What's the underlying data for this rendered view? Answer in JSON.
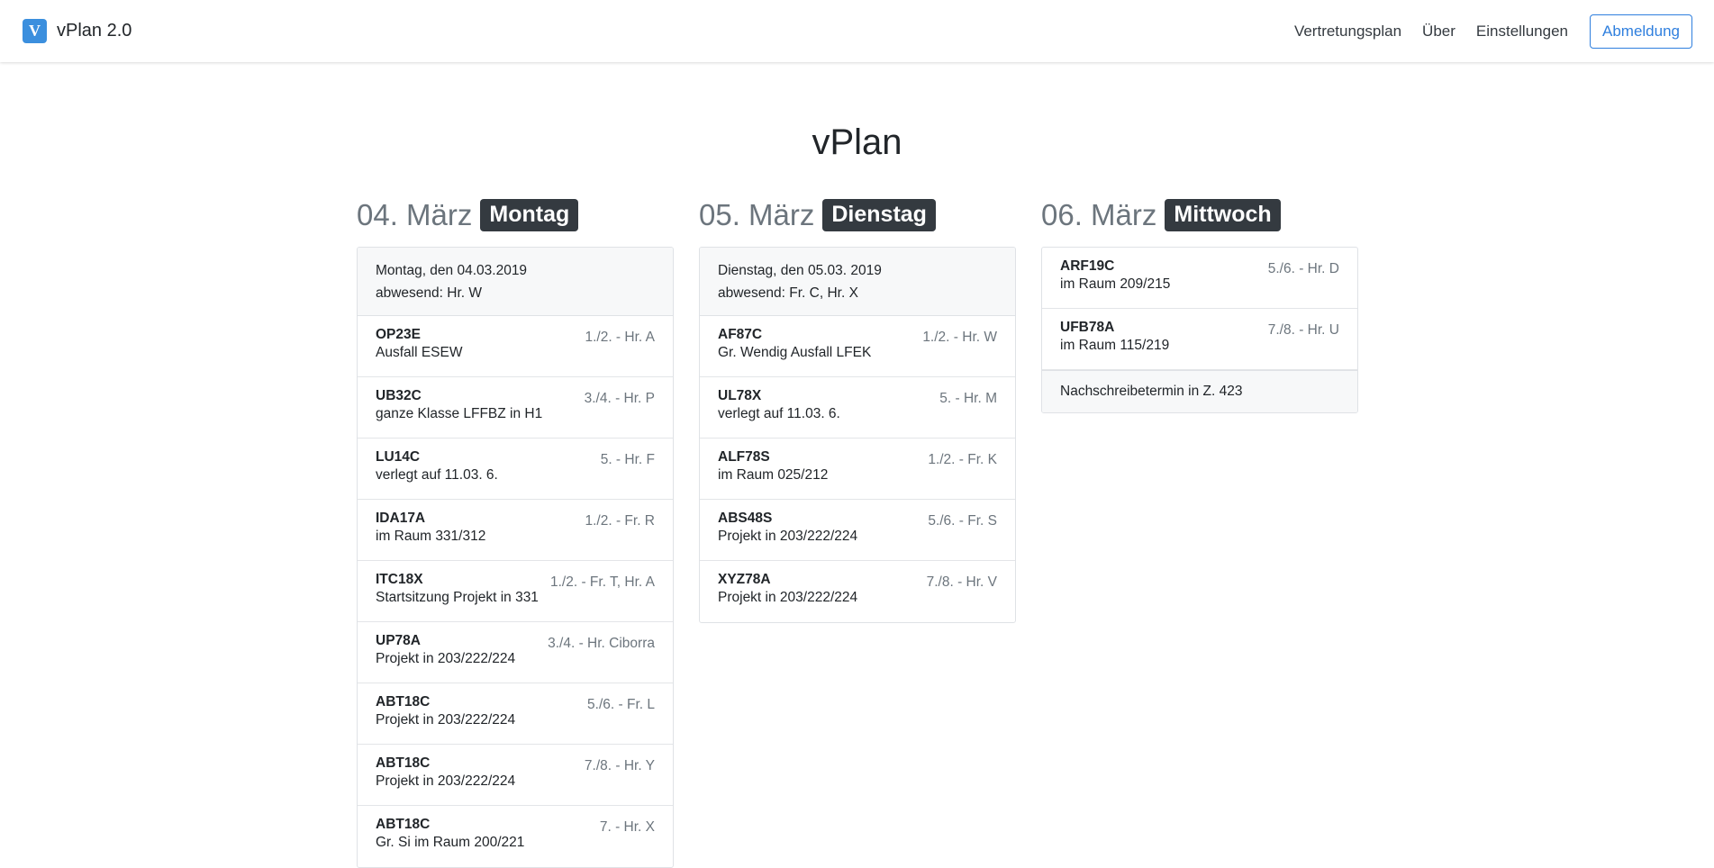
{
  "nav": {
    "brand_logo": "VP",
    "brand": "vPlan 2.0",
    "links": [
      "Vertretungsplan",
      "Über",
      "Einstellungen"
    ],
    "logout": "Abmeldung"
  },
  "page_title": "vPlan",
  "days": [
    {
      "date": "04. März",
      "weekday": "Montag",
      "info_line1": "Montag, den 04.03.2019",
      "info_line2": "abwesend: Hr. W",
      "entries": [
        {
          "cls": "OP23E",
          "desc": "Ausfall ESEW",
          "time": "1./2. - Hr. A"
        },
        {
          "cls": "UB32C",
          "desc": "ganze Klasse LFFBZ in H1",
          "time": "3./4. - Hr. P"
        },
        {
          "cls": "LU14C",
          "desc": "verlegt auf 11.03. 6.",
          "time": "5. - Hr. F"
        },
        {
          "cls": "IDA17A",
          "desc": "im Raum 331/312",
          "time": "1./2. - Fr. R"
        },
        {
          "cls": "ITC18X",
          "desc": "Startsitzung Projekt in 331",
          "time": "1./2. - Fr. T, Hr. A"
        },
        {
          "cls": "UP78A",
          "desc": "Projekt in 203/222/224",
          "time": "3./4. - Hr. Ciborra"
        },
        {
          "cls": "ABT18C",
          "desc": "Projekt in 203/222/224",
          "time": "5./6. - Fr. L"
        },
        {
          "cls": "ABT18C",
          "desc": "Projekt in 203/222/224",
          "time": "7./8. - Hr. Y"
        },
        {
          "cls": "ABT18C",
          "desc": "Gr. Si im Raum 200/221",
          "time": "7. - Hr. X"
        }
      ]
    },
    {
      "date": "05. März",
      "weekday": "Dienstag",
      "info_line1": "Dienstag, den 05.03. 2019",
      "info_line2": "abwesend: Fr. C, Hr. X",
      "entries": [
        {
          "cls": "AF87C",
          "desc": "Gr. Wendig Ausfall LFEK",
          "time": "1./2. - Hr. W"
        },
        {
          "cls": "UL78X",
          "desc": "verlegt auf 11.03. 6.",
          "time": "5. - Hr. M"
        },
        {
          "cls": "ALF78S",
          "desc": "im Raum 025/212",
          "time": "1./2. - Fr. K"
        },
        {
          "cls": "ABS48S",
          "desc": "Projekt in 203/222/224",
          "time": "5./6. - Fr. S"
        },
        {
          "cls": "XYZ78A",
          "desc": "Projekt in 203/222/224",
          "time": "7./8. - Hr. V"
        }
      ]
    },
    {
      "date": "06. März",
      "weekday": "Mittwoch",
      "entries": [
        {
          "cls": "ARF19C",
          "desc": "im Raum 209/215",
          "time": "5./6. - Hr. D"
        },
        {
          "cls": "UFB78A",
          "desc": "im Raum 115/219",
          "time": "7./8. - Hr. U"
        }
      ],
      "note": "Nachschreibetermin in Z. 423"
    }
  ]
}
